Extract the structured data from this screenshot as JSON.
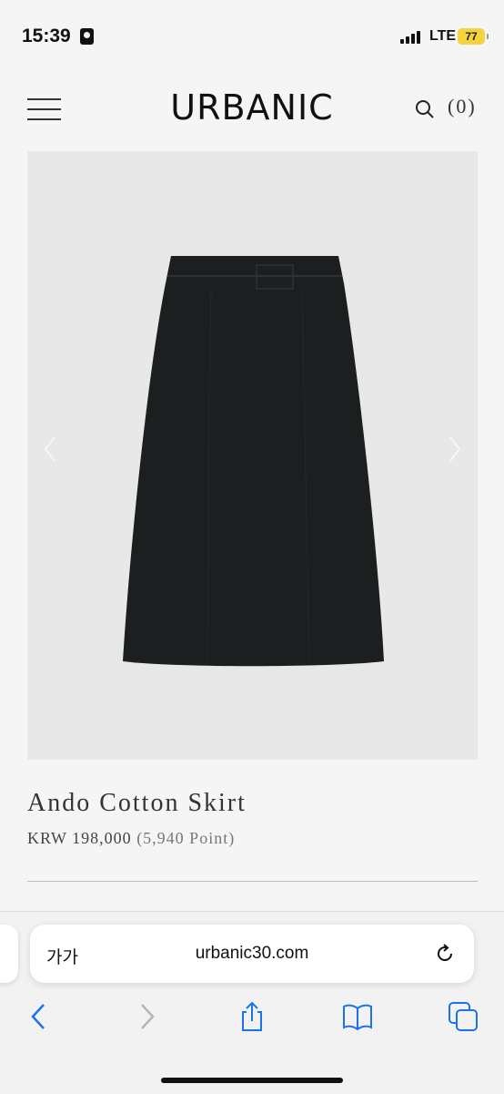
{
  "status_bar": {
    "time": "15:39",
    "network": "LTE",
    "battery": "77"
  },
  "header": {
    "logo": "URBANIC",
    "cart_count": "(0)"
  },
  "product": {
    "name": "Ando Cotton Skirt",
    "price": "KRW 198,000",
    "points": "(5,940 Point)"
  },
  "browser": {
    "text_size_label": "가가",
    "url": "urbanic30.com"
  },
  "icons": {
    "menu": "hamburger-icon",
    "search": "search-icon",
    "reload": "reload-icon",
    "back": "chevron-left-icon",
    "forward": "chevron-right-icon",
    "share": "share-icon",
    "bookmarks": "book-icon",
    "tabs": "tabs-icon"
  },
  "colors": {
    "accent": "#1a73e8",
    "battery": "#f5d33c",
    "image_bg": "#e8e8e8"
  }
}
